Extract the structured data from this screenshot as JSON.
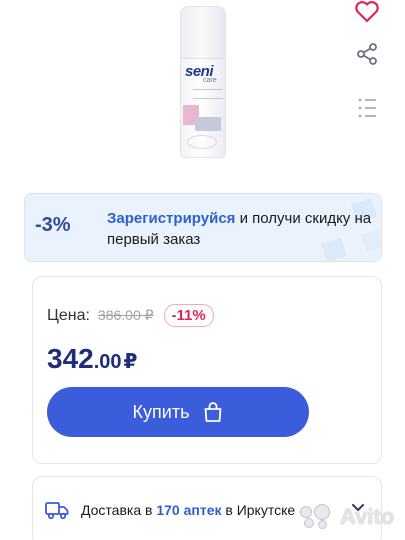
{
  "product": {
    "image_brand": "seni",
    "image_sub": "care",
    "image_icon": "lotion-bottle-image"
  },
  "side_actions": {
    "favorite_icon": "heart-icon",
    "share_icon": "share-icon",
    "list_icon": "list-icon"
  },
  "promo": {
    "badge": "-3%",
    "link_text": "Зарегистрируйся",
    "text_rest": " и получи скидку на первый заказ"
  },
  "price": {
    "label": "Цена:",
    "old_price": "386.00 ₽",
    "discount": "-11%",
    "current_int": "342",
    "current_dec": ".00",
    "currency": "₽"
  },
  "buy": {
    "label": "Купить",
    "icon": "shopping-bag-icon"
  },
  "delivery": {
    "icon": "truck-icon",
    "prefix": "Доставка в ",
    "count": "170 аптек",
    "suffix": " в Иркутске",
    "chevron_icon": "chevron-down-icon"
  },
  "watermark": {
    "text": "Avito"
  },
  "colors": {
    "brand_blue": "#3b5ddb",
    "price_blue": "#1f2e7a",
    "link_blue": "#2e5fd1",
    "discount_pink": "#e0245e",
    "heart_pink": "#e0245e"
  }
}
